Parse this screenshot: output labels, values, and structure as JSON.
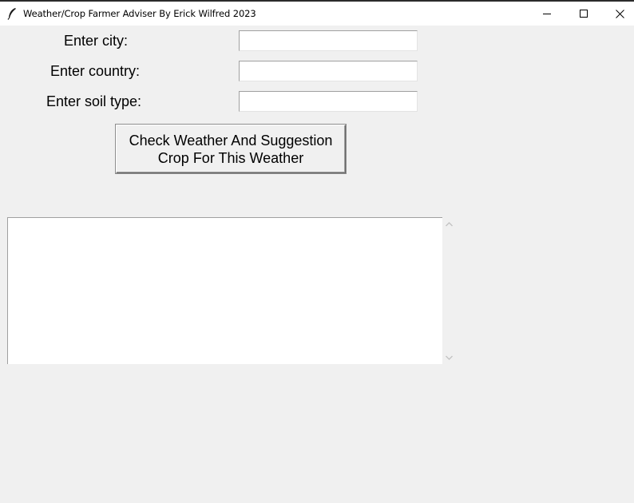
{
  "window": {
    "title": "Weather/Crop Farmer Adviser By Erick Wilfred 2023",
    "icon": "feather-icon",
    "controls": [
      "minimize-icon",
      "maximize-icon",
      "close-icon"
    ]
  },
  "form": {
    "city_label": "Enter city:",
    "city_value": "",
    "country_label": "Enter country:",
    "country_value": "",
    "soil_label": "Enter soil type:",
    "soil_value": ""
  },
  "button": {
    "line1": "Check Weather And Suggestion",
    "line2": "Crop For This Weather"
  },
  "output": {
    "text": ""
  }
}
